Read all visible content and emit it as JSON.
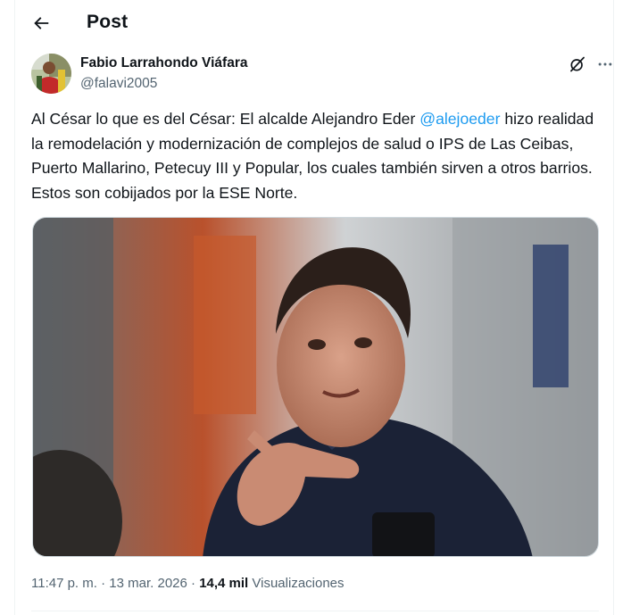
{
  "header": {
    "title": "Post"
  },
  "post": {
    "author": {
      "display_name": "Fabio Larrahondo Viáfara",
      "handle": "@falavi2005"
    },
    "text": {
      "part1": "Al César lo que es del César: El alcalde Alejandro Eder ",
      "mention": "@alejoeder",
      "part2": " hizo realidad la remodelación y modernización de complejos de salud o IPS de Las Ceibas, Puerto Mallarino, Petecuy III y Popular, los cuales también sirven a otros barrios. Estos son cobijados por la ESE Norte."
    },
    "meta": {
      "time": "11:47 p. m.",
      "separator": " · ",
      "date": "13 mar. 2026",
      "views_count": "14,4 mil",
      "views_label": " Visualizaciones"
    }
  },
  "icons": {
    "back": "arrow-left-icon",
    "grok": "grok-icon",
    "more": "more-horizontal-icon"
  },
  "colors": {
    "accent": "#1d9bf0",
    "text_primary": "#0f1419",
    "text_secondary": "#536471",
    "border": "#eff3f4"
  }
}
